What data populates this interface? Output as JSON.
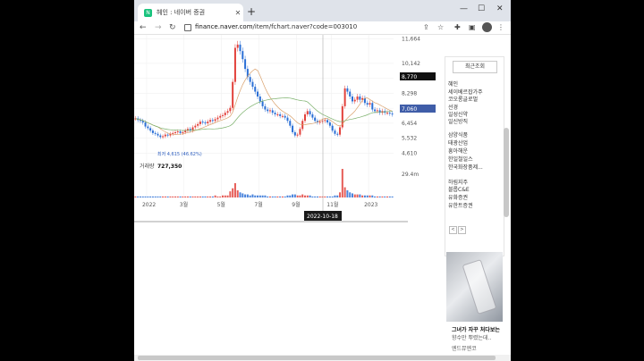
{
  "browser": {
    "tab_title": "헤인 : 네이버 증권",
    "tab_favicon": "N",
    "new_tab": "+",
    "url_domain": "finance.naver.com",
    "url_path": "/item/fchart.naver?code=003010"
  },
  "sidebar": {
    "tab_label": "최근조회",
    "items": [
      "혜인",
      "세이베르잡가주",
      "코오롱글로벌",
      "선경",
      "일성신약",
      "일신방직",
      "삼양식품",
      "태광산업",
      "흥아해운",
      "한일철일스",
      "한국화장품제...",
      "하림지주",
      "블롭C&E",
      "유화증권",
      "유한트증권"
    ],
    "prev": "<",
    "next": ">"
  },
  "ad": {
    "title": "그녀가 자꾸 처다보는",
    "subtitle": "향수만 뿌렸는데..",
    "source": "엔드뮤엔코"
  },
  "chart_data": {
    "type": "candlestick",
    "y_ticks": [
      "11,664",
      "10,142",
      "9,220",
      "8,298",
      "7,376",
      "6,454",
      "5,532",
      "4,610"
    ],
    "current_price": "8,770",
    "ma_price": "7,060",
    "low_label": "최저 4,615 (46.62%)",
    "volume_label": "거래량",
    "volume_value": "727,350",
    "volume_axis": "29.4m",
    "x_ticks": [
      "2022",
      "3월",
      "5월",
      "7월",
      "9월",
      "11월",
      "2023"
    ],
    "crosshair_date": "2022-10-18",
    "price_range": [
      4300,
      11900
    ],
    "closes": [
      6750,
      6650,
      6600,
      6500,
      6250,
      6150,
      6000,
      5850,
      5800,
      5700,
      5600,
      5650,
      5750,
      5700,
      5800,
      5850,
      5900,
      5950,
      5850,
      5900,
      6000,
      6100,
      6000,
      6200,
      6300,
      6400,
      6550,
      6500,
      6450,
      6550,
      6650,
      6600,
      6700,
      6800,
      6900,
      6950,
      7100,
      7200,
      7400,
      9000,
      11100,
      11300,
      10900,
      10400,
      9800,
      9300,
      9000,
      8700,
      8400,
      8100,
      7800,
      7500,
      7300,
      7200,
      7250,
      7100,
      7000,
      7000,
      6900,
      6900,
      6800,
      6600,
      6300,
      5900,
      5700,
      5750,
      6100,
      6600,
      7000,
      7200,
      7000,
      6800,
      6600,
      6500,
      6550,
      6600,
      6650,
      6500,
      6300,
      6000,
      5800,
      5750,
      6200,
      7500,
      8600,
      8400,
      8100,
      7800,
      7900,
      8100,
      7900,
      8000,
      7700,
      7600,
      7700,
      7300,
      7200,
      7250,
      7100,
      7200,
      7100,
      7100,
      7050,
      7000
    ],
    "volumes": [
      1,
      1,
      1,
      1,
      1,
      1,
      1,
      1,
      1,
      1,
      1,
      1,
      1,
      1,
      1,
      1,
      1,
      1,
      1,
      1,
      1,
      1,
      1,
      1,
      1,
      1,
      1,
      1,
      1,
      1,
      1,
      1,
      2,
      1,
      1,
      2,
      2,
      2,
      6,
      9,
      14,
      7,
      5,
      4,
      3,
      3,
      2,
      3,
      2,
      2,
      2,
      2,
      2,
      1,
      1,
      1,
      1,
      1,
      1,
      1,
      1,
      2,
      2,
      3,
      3,
      2,
      2,
      3,
      2,
      2,
      2,
      1,
      1,
      1,
      1,
      1,
      1,
      1,
      1,
      1,
      2,
      2,
      5,
      28,
      10,
      7,
      5,
      4,
      3,
      3,
      3,
      2,
      2,
      2,
      2,
      2,
      1,
      1,
      1,
      1,
      1,
      1,
      1,
      1
    ],
    "colors": {
      "up": "#e2413b",
      "down": "#2a6fd6",
      "price_tag": "#111111",
      "ma_tag": "#3f5da8"
    }
  }
}
